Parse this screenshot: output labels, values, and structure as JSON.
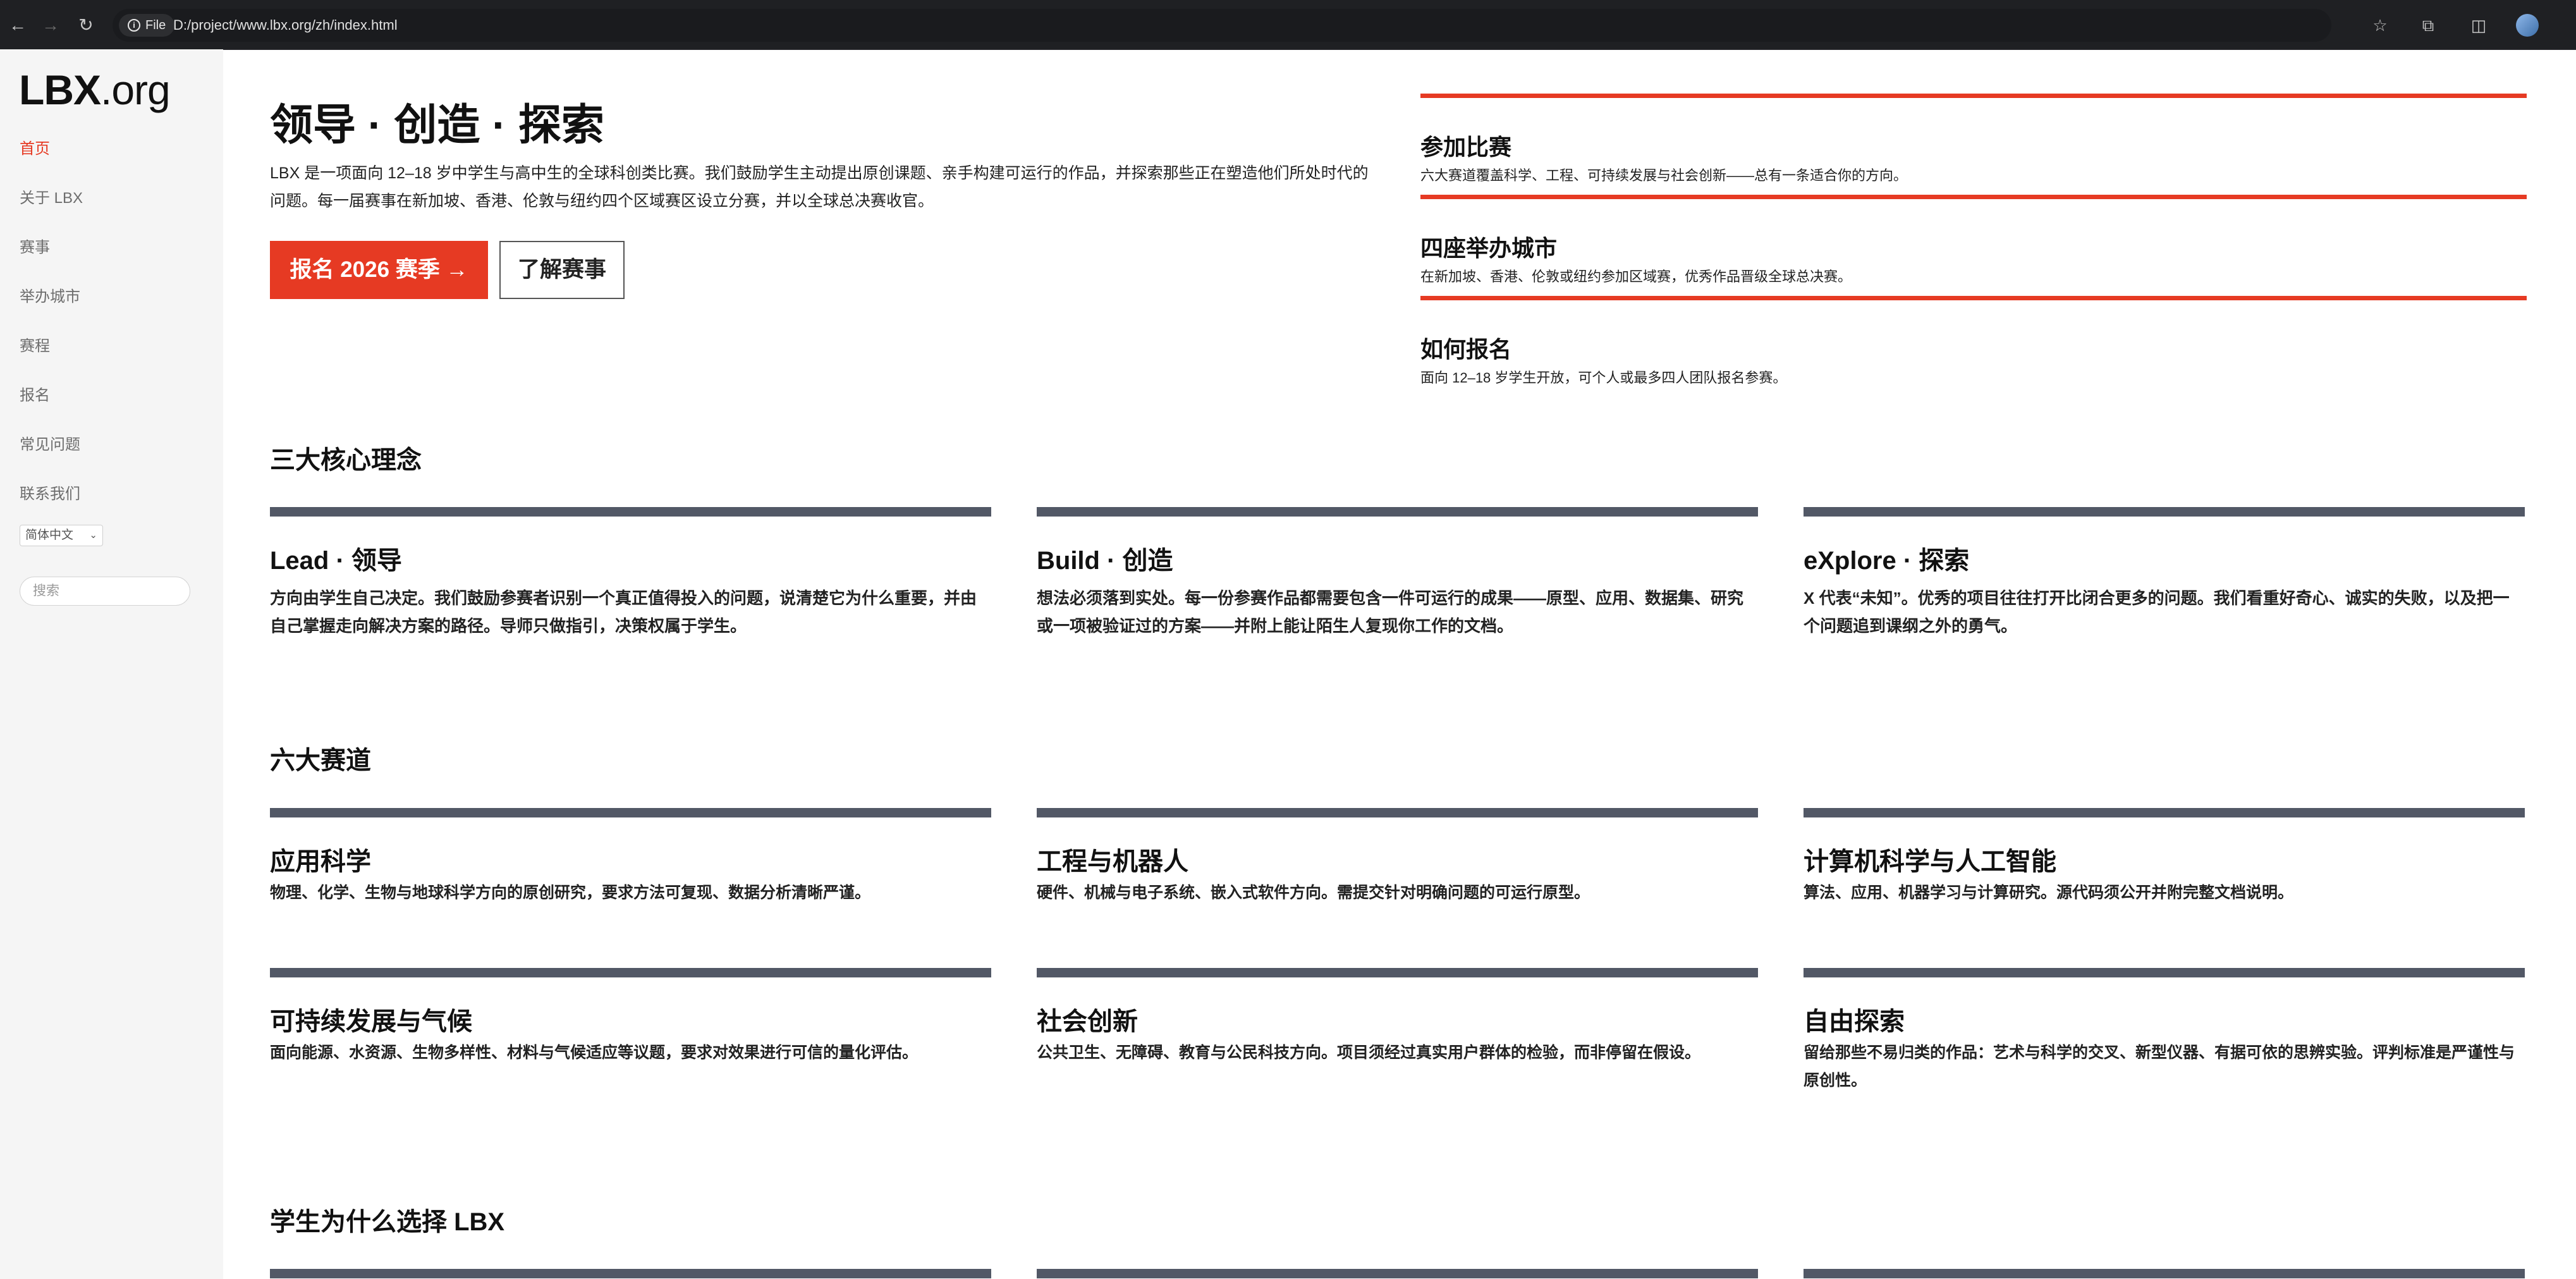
{
  "browser": {
    "file_chip": "File",
    "url": "D:/project/www.lbx.org/zh/index.html"
  },
  "sidebar": {
    "logo_lbx": "LBX",
    "logo_org": ".org",
    "nav": [
      "首页",
      "关于 LBX",
      "赛事",
      "举办城市",
      "赛程",
      "报名",
      "常见问题",
      "联系我们"
    ],
    "active_index": 0,
    "language": "简体中文",
    "search_placeholder": "搜索"
  },
  "hero": {
    "title": "领导 · 创造 · 探索",
    "description": "LBX 是一项面向 12–18 岁中学生与高中生的全球科创类比赛。我们鼓励学生主动提出原创课题、亲手构建可运行的作品，并探索那些正在塑造他们所处时代的问题。每一届赛事在新加坡、香港、伦敦与纽约四个区域赛区设立分赛，并以全球总决赛收官。",
    "primary_button": "报名 2026 赛季 →",
    "secondary_button": "了解赛事"
  },
  "info_blocks": [
    {
      "title": "参加比赛",
      "desc": "六大赛道覆盖科学、工程、可持续发展与社会创新——总有一条适合你的方向。"
    },
    {
      "title": "四座举办城市",
      "desc": "在新加坡、香港、伦敦或纽约参加区域赛，优秀作品晋级全球总决赛。"
    },
    {
      "title": "如何报名",
      "desc": "面向 12–18 岁学生开放，可个人或最多四人团队报名参赛。"
    }
  ],
  "core": {
    "heading": "三大核心理念",
    "items": [
      {
        "title": "Lead · 领导",
        "desc": "方向由学生自己决定。我们鼓励参赛者识别一个真正值得投入的问题，说清楚它为什么重要，并由自己掌握走向解决方案的路径。导师只做指引，决策权属于学生。"
      },
      {
        "title": "Build · 创造",
        "desc": "想法必须落到实处。每一份参赛作品都需要包含一件可运行的成果——原型、应用、数据集、研究或一项被验证过的方案——并附上能让陌生人复现你工作的文档。"
      },
      {
        "title": "eXplore · 探索",
        "desc": "X 代表“未知”。优秀的项目往往打开比闭合更多的问题。我们看重好奇心、诚实的失败，以及把一个问题追到课纲之外的勇气。"
      }
    ]
  },
  "tracks": {
    "heading": "六大赛道",
    "items": [
      {
        "title": "应用科学",
        "desc": "物理、化学、生物与地球科学方向的原创研究，要求方法可复现、数据分析清晰严谨。"
      },
      {
        "title": "工程与机器人",
        "desc": "硬件、机械与电子系统、嵌入式软件方向。需提交针对明确问题的可运行原型。"
      },
      {
        "title": "计算机科学与人工智能",
        "desc": "算法、应用、机器学习与计算研究。源代码须公开并附完整文档说明。"
      },
      {
        "title": "可持续发展与气候",
        "desc": "面向能源、水资源、生物多样性、材料与气候适应等议题，要求对效果进行可信的量化评估。"
      },
      {
        "title": "社会创新",
        "desc": "公共卫生、无障碍、教育与公民科技方向。项目须经过真实用户群体的检验，而非停留在假设。"
      },
      {
        "title": "自由探索",
        "desc": "留给那些不易归类的作品：艺术与科学的交叉、新型仪器、有据可依的思辨实验。评判标准是严谨性与原创性。"
      }
    ]
  },
  "why": {
    "heading": "学生为什么选择 LBX"
  }
}
